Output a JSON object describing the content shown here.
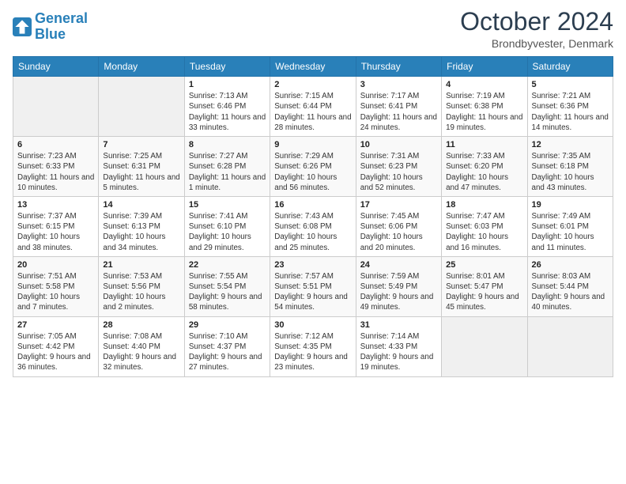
{
  "header": {
    "logo_line1": "General",
    "logo_line2": "Blue",
    "month": "October 2024",
    "location": "Brondbyvester, Denmark"
  },
  "weekdays": [
    "Sunday",
    "Monday",
    "Tuesday",
    "Wednesday",
    "Thursday",
    "Friday",
    "Saturday"
  ],
  "weeks": [
    [
      {
        "day": "",
        "sunrise": "",
        "sunset": "",
        "daylight": ""
      },
      {
        "day": "",
        "sunrise": "",
        "sunset": "",
        "daylight": ""
      },
      {
        "day": "1",
        "sunrise": "Sunrise: 7:13 AM",
        "sunset": "Sunset: 6:46 PM",
        "daylight": "Daylight: 11 hours and 33 minutes."
      },
      {
        "day": "2",
        "sunrise": "Sunrise: 7:15 AM",
        "sunset": "Sunset: 6:44 PM",
        "daylight": "Daylight: 11 hours and 28 minutes."
      },
      {
        "day": "3",
        "sunrise": "Sunrise: 7:17 AM",
        "sunset": "Sunset: 6:41 PM",
        "daylight": "Daylight: 11 hours and 24 minutes."
      },
      {
        "day": "4",
        "sunrise": "Sunrise: 7:19 AM",
        "sunset": "Sunset: 6:38 PM",
        "daylight": "Daylight: 11 hours and 19 minutes."
      },
      {
        "day": "5",
        "sunrise": "Sunrise: 7:21 AM",
        "sunset": "Sunset: 6:36 PM",
        "daylight": "Daylight: 11 hours and 14 minutes."
      }
    ],
    [
      {
        "day": "6",
        "sunrise": "Sunrise: 7:23 AM",
        "sunset": "Sunset: 6:33 PM",
        "daylight": "Daylight: 11 hours and 10 minutes."
      },
      {
        "day": "7",
        "sunrise": "Sunrise: 7:25 AM",
        "sunset": "Sunset: 6:31 PM",
        "daylight": "Daylight: 11 hours and 5 minutes."
      },
      {
        "day": "8",
        "sunrise": "Sunrise: 7:27 AM",
        "sunset": "Sunset: 6:28 PM",
        "daylight": "Daylight: 11 hours and 1 minute."
      },
      {
        "day": "9",
        "sunrise": "Sunrise: 7:29 AM",
        "sunset": "Sunset: 6:26 PM",
        "daylight": "Daylight: 10 hours and 56 minutes."
      },
      {
        "day": "10",
        "sunrise": "Sunrise: 7:31 AM",
        "sunset": "Sunset: 6:23 PM",
        "daylight": "Daylight: 10 hours and 52 minutes."
      },
      {
        "day": "11",
        "sunrise": "Sunrise: 7:33 AM",
        "sunset": "Sunset: 6:20 PM",
        "daylight": "Daylight: 10 hours and 47 minutes."
      },
      {
        "day": "12",
        "sunrise": "Sunrise: 7:35 AM",
        "sunset": "Sunset: 6:18 PM",
        "daylight": "Daylight: 10 hours and 43 minutes."
      }
    ],
    [
      {
        "day": "13",
        "sunrise": "Sunrise: 7:37 AM",
        "sunset": "Sunset: 6:15 PM",
        "daylight": "Daylight: 10 hours and 38 minutes."
      },
      {
        "day": "14",
        "sunrise": "Sunrise: 7:39 AM",
        "sunset": "Sunset: 6:13 PM",
        "daylight": "Daylight: 10 hours and 34 minutes."
      },
      {
        "day": "15",
        "sunrise": "Sunrise: 7:41 AM",
        "sunset": "Sunset: 6:10 PM",
        "daylight": "Daylight: 10 hours and 29 minutes."
      },
      {
        "day": "16",
        "sunrise": "Sunrise: 7:43 AM",
        "sunset": "Sunset: 6:08 PM",
        "daylight": "Daylight: 10 hours and 25 minutes."
      },
      {
        "day": "17",
        "sunrise": "Sunrise: 7:45 AM",
        "sunset": "Sunset: 6:06 PM",
        "daylight": "Daylight: 10 hours and 20 minutes."
      },
      {
        "day": "18",
        "sunrise": "Sunrise: 7:47 AM",
        "sunset": "Sunset: 6:03 PM",
        "daylight": "Daylight: 10 hours and 16 minutes."
      },
      {
        "day": "19",
        "sunrise": "Sunrise: 7:49 AM",
        "sunset": "Sunset: 6:01 PM",
        "daylight": "Daylight: 10 hours and 11 minutes."
      }
    ],
    [
      {
        "day": "20",
        "sunrise": "Sunrise: 7:51 AM",
        "sunset": "Sunset: 5:58 PM",
        "daylight": "Daylight: 10 hours and 7 minutes."
      },
      {
        "day": "21",
        "sunrise": "Sunrise: 7:53 AM",
        "sunset": "Sunset: 5:56 PM",
        "daylight": "Daylight: 10 hours and 2 minutes."
      },
      {
        "day": "22",
        "sunrise": "Sunrise: 7:55 AM",
        "sunset": "Sunset: 5:54 PM",
        "daylight": "Daylight: 9 hours and 58 minutes."
      },
      {
        "day": "23",
        "sunrise": "Sunrise: 7:57 AM",
        "sunset": "Sunset: 5:51 PM",
        "daylight": "Daylight: 9 hours and 54 minutes."
      },
      {
        "day": "24",
        "sunrise": "Sunrise: 7:59 AM",
        "sunset": "Sunset: 5:49 PM",
        "daylight": "Daylight: 9 hours and 49 minutes."
      },
      {
        "day": "25",
        "sunrise": "Sunrise: 8:01 AM",
        "sunset": "Sunset: 5:47 PM",
        "daylight": "Daylight: 9 hours and 45 minutes."
      },
      {
        "day": "26",
        "sunrise": "Sunrise: 8:03 AM",
        "sunset": "Sunset: 5:44 PM",
        "daylight": "Daylight: 9 hours and 40 minutes."
      }
    ],
    [
      {
        "day": "27",
        "sunrise": "Sunrise: 7:05 AM",
        "sunset": "Sunset: 4:42 PM",
        "daylight": "Daylight: 9 hours and 36 minutes."
      },
      {
        "day": "28",
        "sunrise": "Sunrise: 7:08 AM",
        "sunset": "Sunset: 4:40 PM",
        "daylight": "Daylight: 9 hours and 32 minutes."
      },
      {
        "day": "29",
        "sunrise": "Sunrise: 7:10 AM",
        "sunset": "Sunset: 4:37 PM",
        "daylight": "Daylight: 9 hours and 27 minutes."
      },
      {
        "day": "30",
        "sunrise": "Sunrise: 7:12 AM",
        "sunset": "Sunset: 4:35 PM",
        "daylight": "Daylight: 9 hours and 23 minutes."
      },
      {
        "day": "31",
        "sunrise": "Sunrise: 7:14 AM",
        "sunset": "Sunset: 4:33 PM",
        "daylight": "Daylight: 9 hours and 19 minutes."
      },
      {
        "day": "",
        "sunrise": "",
        "sunset": "",
        "daylight": ""
      },
      {
        "day": "",
        "sunrise": "",
        "sunset": "",
        "daylight": ""
      }
    ]
  ]
}
